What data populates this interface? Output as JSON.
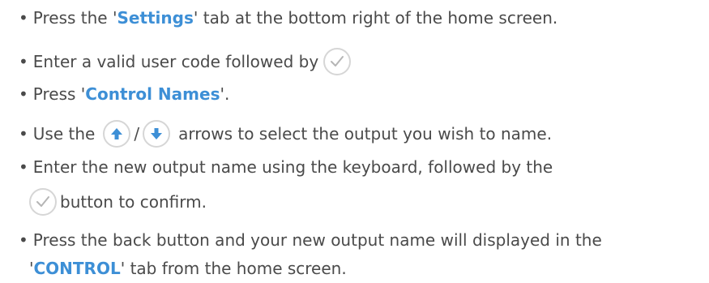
{
  "bullet": "•",
  "steps": {
    "s1": {
      "a": "Press the '",
      "b": "Settings",
      "c": "' tab at the bottom right of the home screen."
    },
    "s2": {
      "a": "Enter a valid user code followed by"
    },
    "s3": {
      "a": "Press '",
      "b": "Control Names",
      "c": "'."
    },
    "s4": {
      "a": "Use the",
      "slash": "/",
      "c": "arrows to select the output you wish to name."
    },
    "s5": {
      "a": "Enter the new output name using the keyboard, followed by the",
      "b": "button to confirm."
    },
    "s6": {
      "a": "Press the back button and your new output name will displayed in the",
      "b1": "'",
      "b": "CONTROL",
      "c": "' tab from the home screen."
    }
  },
  "colors": {
    "text": "#4a4a4a",
    "highlight": "#3d8fd6",
    "icon_arrow": "#3d8fd6",
    "icon_check": "#b5b5b5",
    "icon_border": "#d6d6d6"
  },
  "icons": {
    "confirm": "checkmark-icon",
    "up": "arrow-up-icon",
    "down": "arrow-down-icon"
  }
}
